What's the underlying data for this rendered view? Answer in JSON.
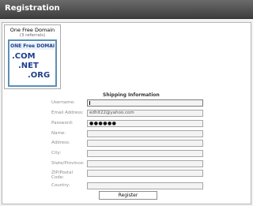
{
  "header": {
    "title": "Registration"
  },
  "promo": {
    "title": "One Free Domain",
    "subtitle": "(3 referrals)",
    "banner_heading": "ONE Free DOMAIN",
    "tld_com": ".COM",
    "tld_net": ".NET",
    "tld_org": ".ORG"
  },
  "form": {
    "section_title": "Shipping Information",
    "fields": [
      {
        "label": "Username:",
        "value": ""
      },
      {
        "label": "Email Address:",
        "value": "edhit22@yahoo.com"
      },
      {
        "label": "Password:",
        "value": "●●●●●●"
      },
      {
        "label": "Name:",
        "value": ""
      },
      {
        "label": "Address:",
        "value": ""
      },
      {
        "label": "City:",
        "value": ""
      },
      {
        "label": "State/Province:",
        "value": ""
      },
      {
        "label": "ZIP/Postal Code:",
        "value": ""
      },
      {
        "label": "Country:",
        "value": ""
      }
    ],
    "register_label": "Register"
  }
}
